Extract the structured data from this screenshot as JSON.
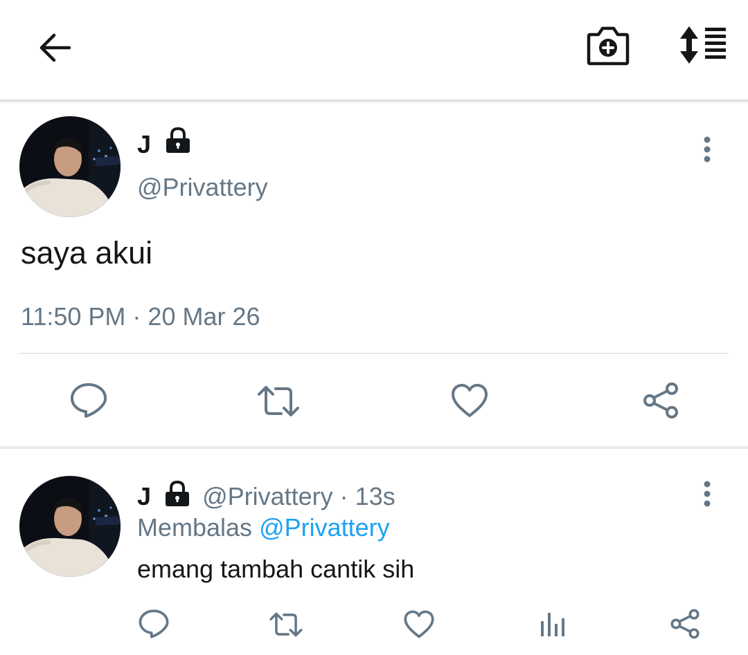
{
  "header": {
    "back_icon": "arrow-left-icon",
    "camera_icon": "camera-plus-icon",
    "sort_icon": "sort-list-icon"
  },
  "main_tweet": {
    "name": "J",
    "lock_icon": "lock-icon",
    "handle": "@Privattery",
    "text": "saya akui",
    "time": "11:50 PM",
    "separator": "·",
    "date": "20 Mar 26",
    "actions": [
      "reply-icon",
      "retweet-icon",
      "like-icon",
      "share-icon"
    ]
  },
  "reply_tweet": {
    "name": "J",
    "handle": "@Privattery",
    "separator": "·",
    "age": "13s",
    "replying_label": "Membalas",
    "replying_to": "@Privattery",
    "text": "emang tambah cantik sih",
    "actions": [
      "reply-icon",
      "retweet-icon",
      "like-icon",
      "analytics-icon",
      "share-icon"
    ]
  },
  "colors": {
    "text_primary": "#14171a",
    "text_secondary": "#657786",
    "link": "#1da1f2",
    "divider": "#e1e8ed"
  }
}
